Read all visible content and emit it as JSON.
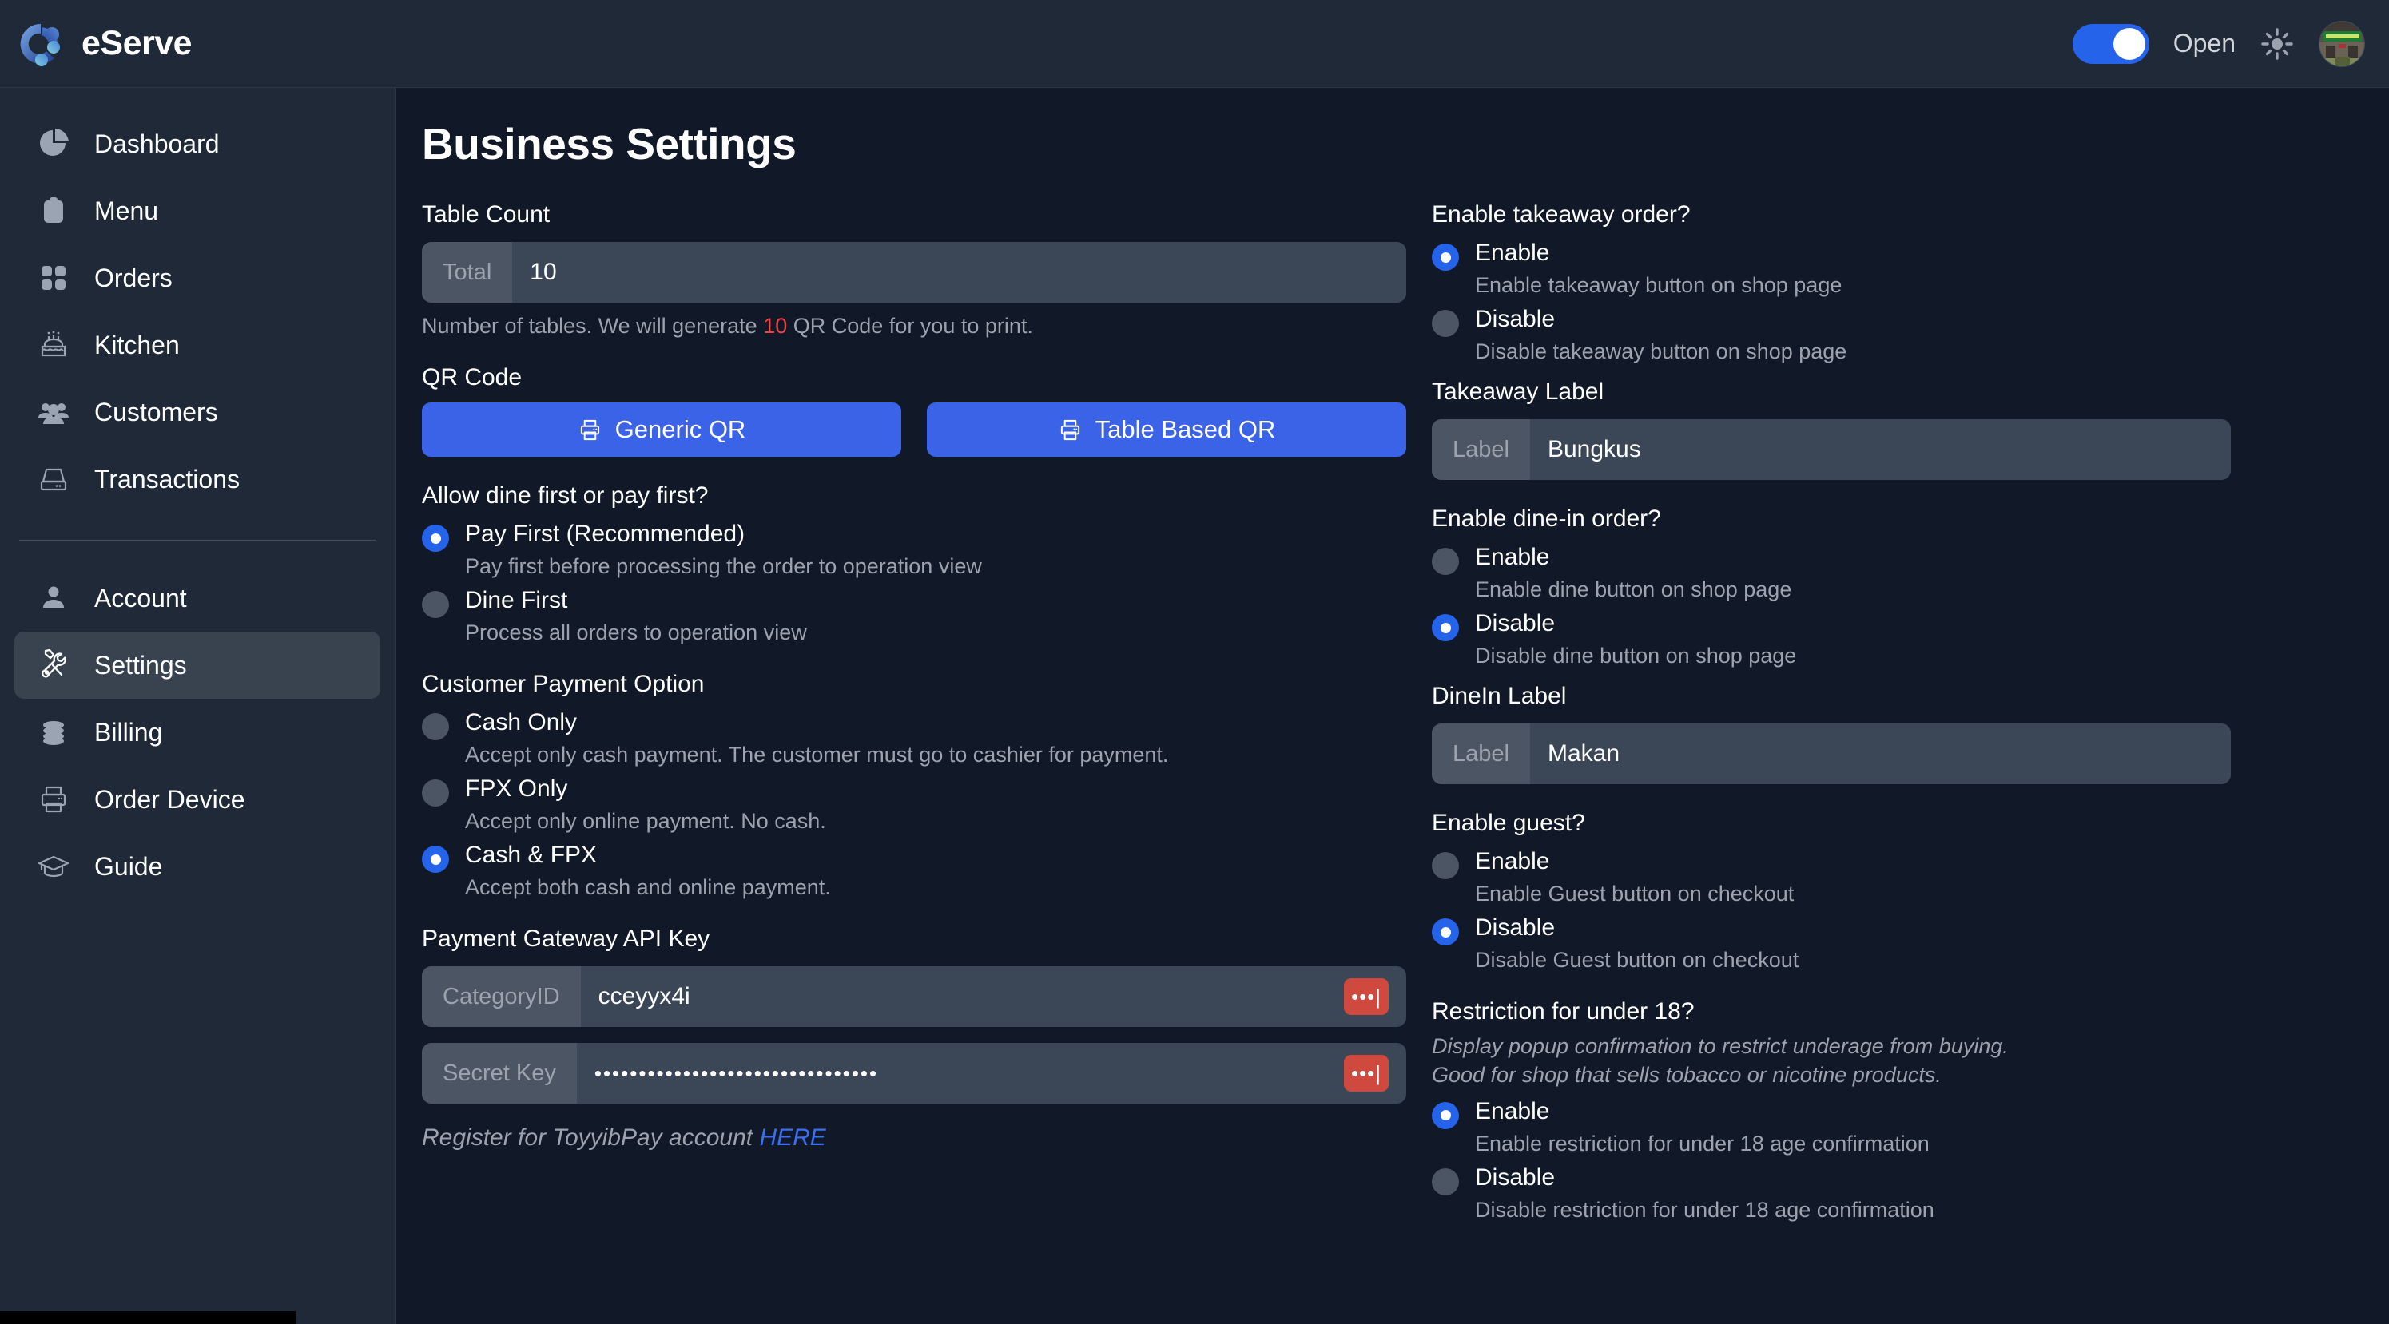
{
  "app": {
    "brand": "eServe",
    "logo_icon": "eserve-logo-icon"
  },
  "topbar": {
    "shop_status_toggle": {
      "state": "on",
      "label": "Open"
    },
    "theme_icon": "sun-icon",
    "avatar_icon": "shop-avatar"
  },
  "sidebar": {
    "items": [
      {
        "label": "Dashboard",
        "icon": "pie-chart-icon",
        "active": false
      },
      {
        "label": "Menu",
        "icon": "clipboard-icon",
        "active": false
      },
      {
        "label": "Orders",
        "icon": "grid-icon",
        "active": false
      },
      {
        "label": "Kitchen",
        "icon": "cake-icon",
        "active": false
      },
      {
        "label": "Customers",
        "icon": "people-icon",
        "active": false
      },
      {
        "label": "Transactions",
        "icon": "drawer-icon",
        "active": false
      }
    ],
    "items2": [
      {
        "label": "Account",
        "icon": "person-icon",
        "active": false
      },
      {
        "label": "Settings",
        "icon": "tools-icon",
        "active": true
      },
      {
        "label": "Billing",
        "icon": "coins-icon",
        "active": false
      },
      {
        "label": "Order Device",
        "icon": "printer-icon",
        "active": false
      },
      {
        "label": "Guide",
        "icon": "graduation-cap-icon",
        "active": false
      }
    ]
  },
  "page": {
    "title": "Business Settings"
  },
  "left": {
    "table_count": {
      "label": "Table Count",
      "addon": "Total",
      "value": "10",
      "helper_pre": "Number of tables. We will generate ",
      "helper_hot": "10",
      "helper_post": " QR Code for you to print."
    },
    "qr_code": {
      "label": "QR Code",
      "generic_btn": "Generic QR",
      "table_btn": "Table Based QR",
      "btn_icon": "printer-icon"
    },
    "dine_or_pay": {
      "label": "Allow dine first or pay first?",
      "options": [
        {
          "title": "Pay First (Recommended)",
          "desc": "Pay first before processing the order to operation view",
          "selected": true
        },
        {
          "title": "Dine First",
          "desc": "Process all orders to operation view",
          "selected": false
        }
      ]
    },
    "payment_option": {
      "label": "Customer Payment Option",
      "options": [
        {
          "title": "Cash Only",
          "desc": "Accept only cash payment. The customer must go to cashier for payment.",
          "selected": false
        },
        {
          "title": "FPX Only",
          "desc": "Accept only online payment. No cash.",
          "selected": false
        },
        {
          "title": "Cash & FPX",
          "desc": "Accept both cash and online payment.",
          "selected": true
        }
      ]
    },
    "api_key": {
      "label": "Payment Gateway API Key",
      "category_addon": "CategoryID",
      "category_value": "cceyyx4i",
      "secret_addon": "Secret Key",
      "secret_value": "••••••••••••••••••••••••••••••••",
      "reveal_icon": "password-dots-icon",
      "register_pre": "Register for ToyyibPay account ",
      "register_link": "HERE"
    }
  },
  "right": {
    "takeaway": {
      "label": "Enable takeaway order?",
      "options": [
        {
          "title": "Enable",
          "desc": "Enable takeaway button on shop page",
          "selected": true
        },
        {
          "title": "Disable",
          "desc": "Disable takeaway button on shop page",
          "selected": false
        }
      ],
      "field_label": "Takeaway Label",
      "field_addon": "Label",
      "field_value": "Bungkus"
    },
    "dinein": {
      "label": "Enable dine-in order?",
      "options": [
        {
          "title": "Enable",
          "desc": "Enable dine button on shop page",
          "selected": false
        },
        {
          "title": "Disable",
          "desc": "Disable dine button on shop page",
          "selected": true
        }
      ],
      "field_label": "DineIn Label",
      "field_addon": "Label",
      "field_value": "Makan"
    },
    "guest": {
      "label": "Enable guest?",
      "options": [
        {
          "title": "Enable",
          "desc": "Enable Guest button on checkout",
          "selected": false
        },
        {
          "title": "Disable",
          "desc": "Disable Guest button on checkout",
          "selected": true
        }
      ]
    },
    "under18": {
      "label": "Restriction for under 18?",
      "note_line1": "Display popup confirmation to restrict underage from buying.",
      "note_line2": "Good for shop that sells tobacco or nicotine products.",
      "options": [
        {
          "title": "Enable",
          "desc": "Enable restriction for under 18 age confirmation",
          "selected": true
        },
        {
          "title": "Disable",
          "desc": "Disable restriction for under 18 age confirmation",
          "selected": false
        }
      ]
    }
  },
  "colors": {
    "accent_blue": "#2563eb",
    "button_blue": "#3b63e8",
    "danger_red": "#d0493f",
    "hot_red": "#ef4444",
    "sidebar_bg": "#1f2937",
    "page_bg": "#111827",
    "field_bg": "#3b4757"
  }
}
